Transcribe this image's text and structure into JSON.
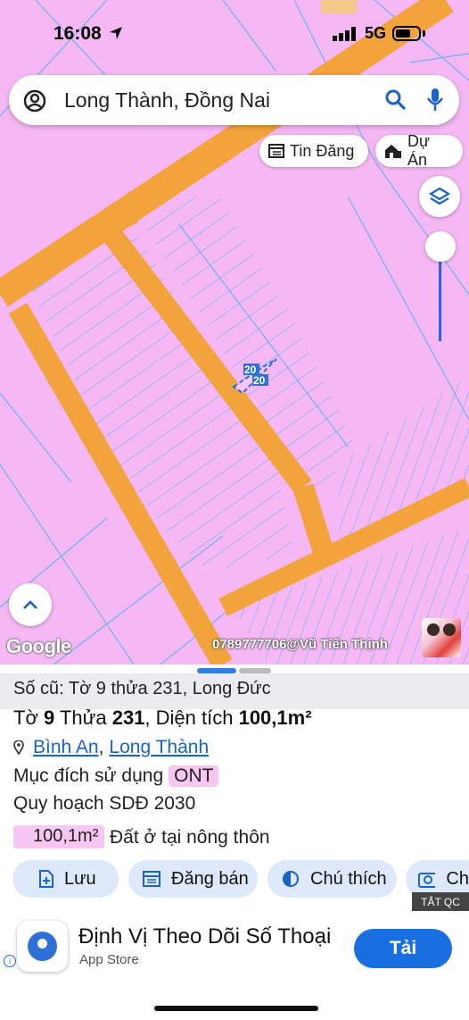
{
  "status_bar": {
    "time": "16:08",
    "network": "5G"
  },
  "search": {
    "value": "Long Thành, Đồng Nai"
  },
  "map_chips": {
    "tin_dang": "Tin Đăng",
    "du_an": "Dự Án"
  },
  "map": {
    "parcel_label_1": "20",
    "parcel_label_2": "20",
    "google_logo": "Google",
    "credit": "0789777706@Vũ Tiến Thịnh"
  },
  "info": {
    "old_record": "Số cũ: Tờ 9 thửa 231, Long Đức",
    "to_label": "Tờ ",
    "to_value": "9",
    "thua_label": " Thửa ",
    "thua_value": "231",
    "area_label": ", Diện tích ",
    "area_value": "100,1m²",
    "ward": "Bình An",
    "separator": ",",
    "district": "Long Thành",
    "purpose_label": "Mục đích sử dụng",
    "purpose_code": "ONT",
    "plan_label": "Quy hoạch SDĐ 2030",
    "area_badge": "100,1m²",
    "area_desc": "Đất ở tại nông thôn"
  },
  "actions": {
    "save": "Lưu",
    "post": "Đăng bán",
    "note": "Chú thích",
    "photo": "Ch"
  },
  "ad": {
    "close_label": "TẮT QC",
    "title": "Định Vị Theo Dõi Số Thoại",
    "store": "App Store",
    "get_button": "Tải",
    "info_mark": "i"
  },
  "colors": {
    "map_background": "#f5b8f5",
    "road": "#f3a33c",
    "accent": "#1a6fe0",
    "ont_badge": "#f7c6f2"
  }
}
